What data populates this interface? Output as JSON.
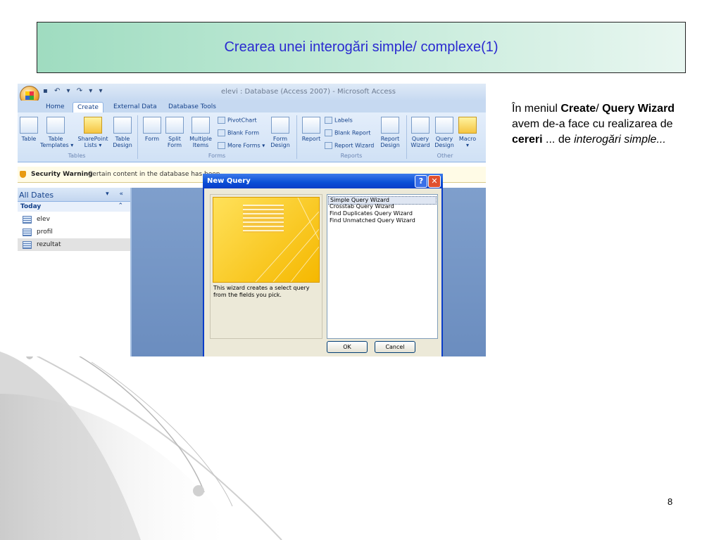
{
  "slide": {
    "title": "Crearea unei interogări simple/ complexe(1)",
    "page_number": "8",
    "body_text": {
      "t1": "În meniul ",
      "b1": "Create",
      "t2": "/ ",
      "b2": "Query Wizard",
      "t3": " avem de-a face cu realizarea de ",
      "b3": "cereri",
      "t4": " ... de ",
      "i1": "interogări simple..."
    }
  },
  "access": {
    "window_title": "elevi : Database (Access 2007) - Microsoft Access",
    "quick_access": "▪ ↶ ▾ ↷ ▾ ▾",
    "tabs": [
      "Home",
      "Create",
      "External Data",
      "Database Tools"
    ],
    "active_tab": "Create",
    "ribbon": {
      "tables": {
        "label": "Tables",
        "table": "Table",
        "table_templates": "Table\nTemplates ▾",
        "sharepoint_lists": "SharePoint\nLists ▾",
        "table_design": "Table\nDesign"
      },
      "forms": {
        "label": "Forms",
        "form": "Form",
        "split_form": "Split\nForm",
        "multiple_items": "Multiple\nItems",
        "pivotchart": "PivotChart",
        "blank_form": "Blank Form",
        "more_forms": "More Forms ▾",
        "form_design": "Form\nDesign"
      },
      "reports": {
        "label": "Reports",
        "report": "Report",
        "labels": "Labels",
        "blank_report": "Blank Report",
        "report_wizard": "Report Wizard",
        "report_design": "Report\nDesign"
      },
      "other": {
        "label": "Other",
        "query_wizard": "Query\nWizard",
        "query_design": "Query\nDesign",
        "macro": "Macro\n▾"
      }
    },
    "security": {
      "title": "Security Warning",
      "message": "Certain content in the database has been"
    },
    "nav": {
      "header": "All Dates",
      "controls": "▾ «",
      "group": "Today",
      "collapse": "⌃",
      "items": [
        "elev",
        "profil",
        "rezultat"
      ],
      "selected": "rezultat"
    },
    "dialog": {
      "title": "New Query",
      "help": "?",
      "close": "✕",
      "description": "This wizard creates a select query from the fields you pick.",
      "options": [
        "Simple Query Wizard",
        "Crosstab Query Wizard",
        "Find Duplicates Query Wizard",
        "Find Unmatched Query Wizard"
      ],
      "selected_option": "Simple Query Wizard",
      "ok": "OK",
      "cancel": "Cancel"
    }
  }
}
